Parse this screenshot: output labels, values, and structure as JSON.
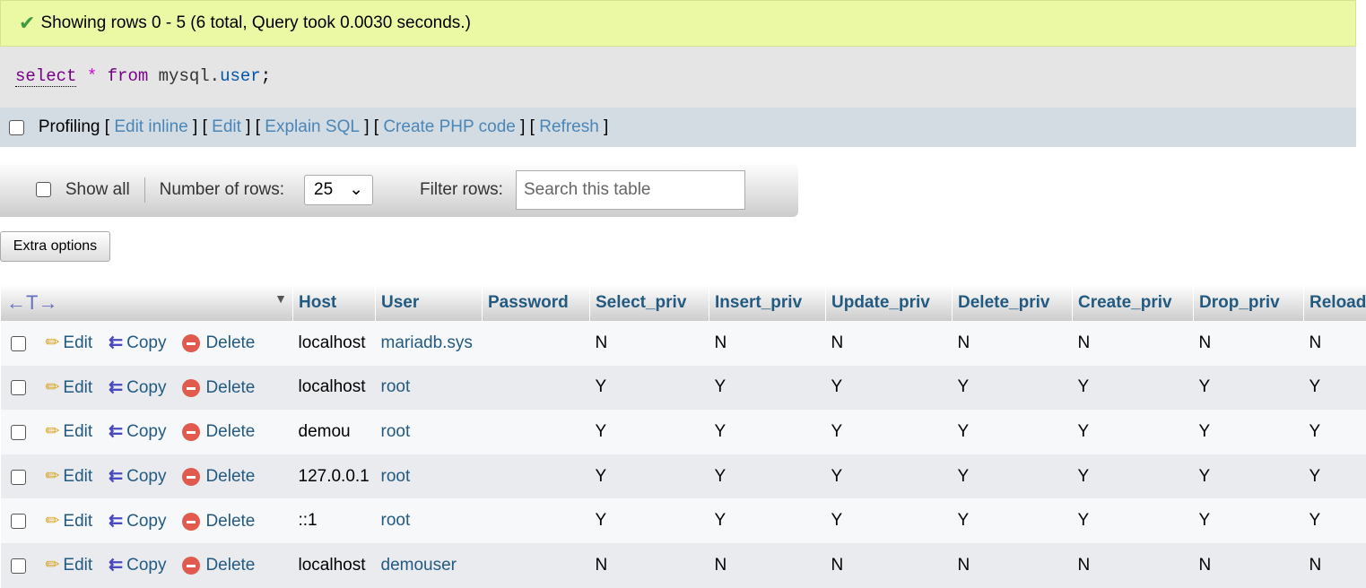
{
  "message": "Showing rows 0 - 5 (6 total, Query took 0.0030 seconds.)",
  "sql": {
    "select": "select",
    "star": "*",
    "from": "from",
    "db": "mysql.",
    "table": "user",
    "end": ";"
  },
  "links": {
    "profiling": "Profiling",
    "items": [
      "Edit inline",
      "Edit",
      "Explain SQL",
      "Create PHP code",
      "Refresh"
    ]
  },
  "nav": {
    "show_all": "Show all",
    "rows_label": "Number of rows:",
    "rows_value": "25",
    "filter_label": "Filter rows:",
    "filter_placeholder": "Search this table"
  },
  "extra_options": "Extra options",
  "table": {
    "columns": [
      "Host",
      "User",
      "Password",
      "Select_priv",
      "Insert_priv",
      "Update_priv",
      "Delete_priv",
      "Create_priv",
      "Drop_priv",
      "Reload"
    ],
    "actions": {
      "edit": "Edit",
      "copy": "Copy",
      "delete": "Delete"
    },
    "rows": [
      [
        "localhost",
        "mariadb.sys",
        "",
        "N",
        "N",
        "N",
        "N",
        "N",
        "N",
        "N"
      ],
      [
        "localhost",
        "root",
        "",
        "Y",
        "Y",
        "Y",
        "Y",
        "Y",
        "Y",
        "Y"
      ],
      [
        "demou",
        "root",
        "",
        "Y",
        "Y",
        "Y",
        "Y",
        "Y",
        "Y",
        "Y"
      ],
      [
        "127.0.0.1",
        "root",
        "",
        "Y",
        "Y",
        "Y",
        "Y",
        "Y",
        "Y",
        "Y"
      ],
      [
        "::1",
        "root",
        "",
        "Y",
        "Y",
        "Y",
        "Y",
        "Y",
        "Y",
        "Y"
      ],
      [
        "localhost",
        "demouser",
        "",
        "N",
        "N",
        "N",
        "N",
        "N",
        "N",
        "N"
      ]
    ]
  }
}
